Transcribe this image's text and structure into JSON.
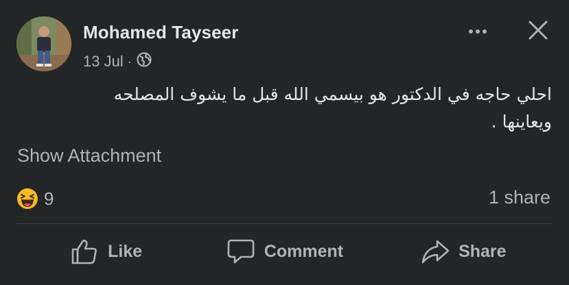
{
  "post": {
    "author": "Mohamed Tayseer",
    "date": "13 Jul",
    "separator": "·",
    "privacy_icon": "globe-icon",
    "text": "احلي حاجه في الدكتور هو بيسمي الله قبل ما يشوف المصلحه ويعاينها .",
    "attachment_label": "Show Attachment"
  },
  "header": {
    "more_icon": "more-horizontal-icon",
    "close_icon": "close-icon"
  },
  "engagement": {
    "reaction_icon": "haha-emoji-icon",
    "reaction_count": "9",
    "shares": "1 share"
  },
  "actions": {
    "like_label": "Like",
    "comment_label": "Comment",
    "share_label": "Share"
  },
  "colors": {
    "background": "#242526",
    "primary_text": "#e4e6eb",
    "secondary_text": "#b0b3b8",
    "divider": "#3e4042",
    "emoji_yellow": "#f7b928"
  }
}
